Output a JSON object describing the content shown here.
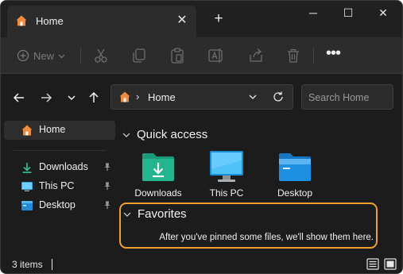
{
  "tab": {
    "title": "Home",
    "close_glyph": "✕"
  },
  "new_tab_glyph": "+",
  "window_controls": {
    "minimize": "─",
    "maximize": "☐",
    "close": "✕"
  },
  "command_bar": {
    "new_label": "New",
    "buttons": [
      "cut-icon",
      "copy-icon",
      "paste-icon",
      "rename-icon",
      "share-icon",
      "delete-icon"
    ],
    "more_glyph": "•••"
  },
  "address": {
    "separator": "›",
    "location": "Home",
    "search_placeholder": "Search Home"
  },
  "sidebar": {
    "items": [
      {
        "label": "Home",
        "icon": "home-icon"
      },
      {
        "label": "Downloads",
        "icon": "downloads-icon",
        "pinned": true
      },
      {
        "label": "This PC",
        "icon": "computer-icon",
        "pinned": true
      },
      {
        "label": "Desktop",
        "icon": "desktop-icon",
        "pinned": true
      }
    ]
  },
  "main": {
    "quick_access": {
      "title": "Quick access",
      "items": [
        {
          "label": "Downloads",
          "icon": "downloads-folder-icon"
        },
        {
          "label": "This PC",
          "icon": "computer-icon"
        },
        {
          "label": "Desktop",
          "icon": "desktop-folder-icon"
        }
      ]
    },
    "favorites": {
      "title": "Favorites",
      "empty_message": "After you've pinned some files, we'll show them here."
    }
  },
  "status": {
    "item_count": "3 items"
  },
  "colors": {
    "highlight_border": "#f0a030",
    "window_bg": "#191919"
  }
}
